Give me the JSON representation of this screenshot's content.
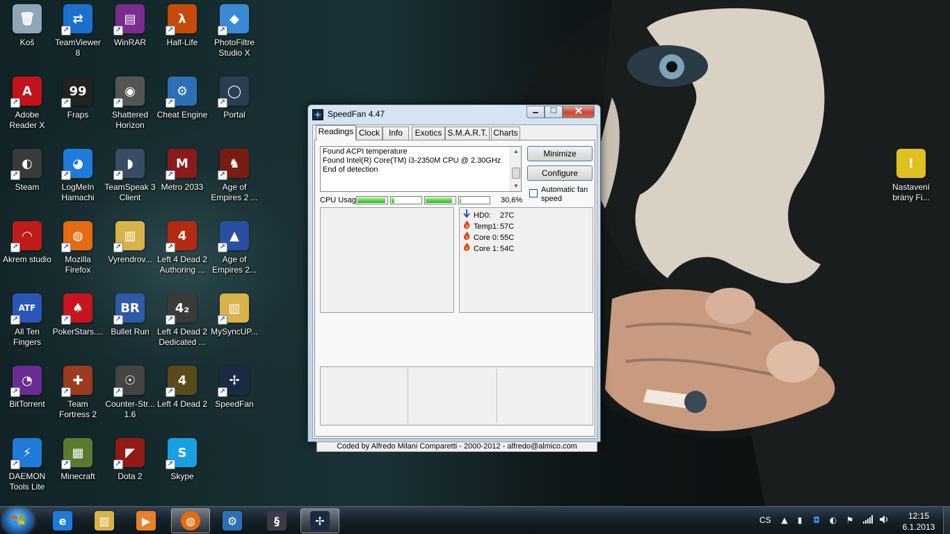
{
  "desktop": {
    "icons": [
      {
        "label": "Koš",
        "color": "#8fa6b8",
        "glyph": "🗑"
      },
      {
        "label": "TeamViewer\n8",
        "color": "#1c6fd1",
        "glyph": "⇄"
      },
      {
        "label": "WinRAR",
        "color": "#7a2d8f",
        "glyph": "▤"
      },
      {
        "label": "Half-Life",
        "color": "#c64a0a",
        "glyph": "λ"
      },
      {
        "label": "PhotoFiltre\nStudio X",
        "color": "#3b8ad6",
        "glyph": "◆"
      },
      {
        "label": "Adobe\nReader X",
        "color": "#c2121b",
        "glyph": "A"
      },
      {
        "label": "Fraps",
        "color": "#222222",
        "glyph": "99"
      },
      {
        "label": "Shattered\nHorizon",
        "color": "#555555",
        "glyph": "◉"
      },
      {
        "label": "Cheat Engine",
        "color": "#2c6fb5",
        "glyph": "⚙"
      },
      {
        "label": "Portal",
        "color": "#2b3d52",
        "glyph": "◯"
      },
      {
        "label": "Steam",
        "color": "#3a3a3a",
        "glyph": "◐"
      },
      {
        "label": "LogMeIn\nHamachi",
        "color": "#1f7ad9",
        "glyph": "◕"
      },
      {
        "label": "TeamSpeak 3\nClient",
        "color": "#3a4b66",
        "glyph": "◗"
      },
      {
        "label": "Metro 2033",
        "color": "#8b1a1a",
        "glyph": "M"
      },
      {
        "label": "Age of\nEmpires 2 ...",
        "color": "#7a1c12",
        "glyph": "♞"
      },
      {
        "label": "Akrem studio",
        "color": "#c11b1b",
        "glyph": "◠"
      },
      {
        "label": "Mozilla\nFirefox",
        "color": "#e46b12",
        "glyph": "◍"
      },
      {
        "label": "Vyrendrov...",
        "color": "#d8b24a",
        "glyph": "▥"
      },
      {
        "label": "Left 4 Dead 2\nAuthoring ...",
        "color": "#b42a12",
        "glyph": "4"
      },
      {
        "label": "Age of\nEmpires 2...",
        "color": "#2a4fa0",
        "glyph": "▲"
      },
      {
        "label": "All Ten\nFingers",
        "color": "#2a56b8",
        "glyph": "ATF"
      },
      {
        "label": "PokerStars....",
        "color": "#c8141e",
        "glyph": "♠"
      },
      {
        "label": "Bullet Run",
        "color": "#2f5aa8",
        "glyph": "BR"
      },
      {
        "label": "Left 4 Dead 2\nDedicated ...",
        "color": "#3a3a3a",
        "glyph": "4₂"
      },
      {
        "label": "MySyncUP...",
        "color": "#d8b24a",
        "glyph": "▥"
      },
      {
        "label": "BitTorrent",
        "color": "#6a2c94",
        "glyph": "◔"
      },
      {
        "label": "Team\nFortress 2",
        "color": "#9c3b1e",
        "glyph": "✚"
      },
      {
        "label": "Counter-Str...\n1.6",
        "color": "#444444",
        "glyph": "☉"
      },
      {
        "label": "Left 4 Dead 2",
        "color": "#5a4a1a",
        "glyph": "4"
      },
      {
        "label": "SpeedFan",
        "color": "#1a2a44",
        "glyph": "✢"
      },
      {
        "label": "DAEMON\nTools Lite",
        "color": "#1f7ad9",
        "glyph": "⚡"
      },
      {
        "label": "Minecraft",
        "color": "#5a7a2e",
        "glyph": "▦"
      },
      {
        "label": "Dota 2",
        "color": "#8f1a16",
        "glyph": "◤"
      },
      {
        "label": "Skype",
        "color": "#1aa0e0",
        "glyph": "S"
      },
      {
        "label": "Nastavení\nbrány Fi...",
        "color": "#e0c020",
        "glyph": "!"
      }
    ]
  },
  "speedfan": {
    "title": "SpeedFan 4.47",
    "tabs": [
      "Readings",
      "Clock",
      "Info",
      "Exotics",
      "S.M.A.R.T.",
      "Charts"
    ],
    "log": [
      "Found ACPI temperature",
      "Found Intel(R) Core(TM) i3-2350M CPU @ 2.30GHz",
      "End of detection"
    ],
    "minimize_label": "Minimize",
    "configure_label": "Configure",
    "auto_fan_label": "Automatic fan speed",
    "cpu_usage_label": "CPU Usage",
    "cpu_usage_value": "30,6%",
    "cpu_bars": [
      0.95,
      0.1,
      0.9,
      0.05
    ],
    "readings": [
      {
        "icon": "down-arrow",
        "name": "HD0:",
        "value": "27C"
      },
      {
        "icon": "flame",
        "name": "Temp1:",
        "value": "57C"
      },
      {
        "icon": "flame",
        "name": "Core 0:",
        "value": "55C"
      },
      {
        "icon": "flame",
        "name": "Core 1:",
        "value": "54C"
      }
    ],
    "footer": "Coded by Alfredo Milani Comparetti - 2000-2012 - alfredo@almico.com"
  },
  "taskbar": {
    "language": "CS",
    "time": "12:15",
    "date": "6.1.2013"
  },
  "colors": {
    "accent": "#3c7fb1",
    "flame": "#e4401a",
    "arrow": "#1b3ea8"
  }
}
